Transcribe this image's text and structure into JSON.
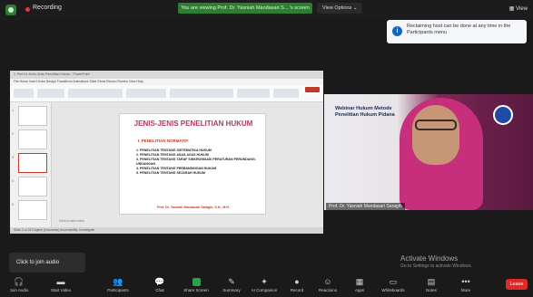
{
  "topbar": {
    "recording_label": "Recording",
    "banner": "You are viewing Prof. Dr. Yasniah Mandasari S... 's screen",
    "view_options": "View Options",
    "view_options_caret": "⌄",
    "view_label": "View"
  },
  "notice": {
    "icon": "i",
    "text": "Reclaiming host can be done at any time in the Participants menu"
  },
  "powerpoint": {
    "window_title": "1. Pert Ke Jenis-Jenis Penelitian Hukum - PowerPoint",
    "tabs": "File   Home   Insert   Draw   Design   Transitions   Animations   Slide Show   Record   Review   View   Help",
    "notes_hint": "Click to add notes",
    "status": "Slide 3 of 24     English (Indonesia)     Accessibility: Investigate",
    "thumb_numbers": [
      "1",
      "2",
      "3",
      "4",
      "5"
    ]
  },
  "slide": {
    "title": "JENIS-JENIS PENELITIAN HUKUM",
    "subtitle": "I.  PENELITIAN NORMATIF:",
    "items": [
      "1.  PENELITIAN TENTANG SISTEMATIKA HUKUM",
      "2.  PENELITIAN TENTANG ASAS-ASAS HUKUM",
      "3.  PENELITIAN TENTANG TARAF SINKRONISASI PERATURAN PERUNDANG-UNDANGAN",
      "4.  PENELITIAN TENTANG PERBANDINGAN HUKUM",
      "5.  PENELITIAN TENTANG SEJARAH HUKUM"
    ],
    "author": "Prof. Dr. Yasniah Mandasari Saragih, S.H., M.H."
  },
  "video": {
    "overlay_text": "Webinar Hukum Metode Penelitian Hukum Pidana",
    "name": "Prof. Dr. Yasniah Mandasari Saragih"
  },
  "tooltip": {
    "text": "Click to join audio"
  },
  "watermark": {
    "title": "Activate Windows",
    "subtitle": "Go to Settings to activate Windows."
  },
  "toolbar": {
    "items": [
      {
        "icon": "headphones-icon",
        "glyph": "🎧",
        "label": "Join Audio"
      },
      {
        "icon": "video-off-icon",
        "glyph": "▬",
        "label": "Start Video"
      },
      {
        "icon": "participants-icon",
        "glyph": "👥",
        "label": "Participants"
      },
      {
        "icon": "chat-icon",
        "glyph": "💬",
        "label": "Chat"
      },
      {
        "icon": "share-screen-icon",
        "glyph": "↑",
        "label": "Share Screen"
      },
      {
        "icon": "summary-icon",
        "glyph": "✎",
        "label": "Summary"
      },
      {
        "icon": "ai-companion-icon",
        "glyph": "✦",
        "label": "AI Companion"
      },
      {
        "icon": "record-icon",
        "glyph": "●",
        "label": "Record"
      },
      {
        "icon": "reactions-icon",
        "glyph": "☺",
        "label": "Reactions"
      },
      {
        "icon": "apps-icon",
        "glyph": "▦",
        "label": "Apps"
      },
      {
        "icon": "whiteboards-icon",
        "glyph": "▭",
        "label": "Whiteboards"
      },
      {
        "icon": "notes-icon",
        "glyph": "▤",
        "label": "Notes"
      },
      {
        "icon": "more-icon",
        "glyph": "•••",
        "label": "More"
      }
    ],
    "leave_label": "Leave"
  },
  "colors": {
    "banner_green": "#2e7d32",
    "leave_red": "#e02828",
    "slide_title": "#b23a5d",
    "slide_accent": "#c0392b"
  }
}
